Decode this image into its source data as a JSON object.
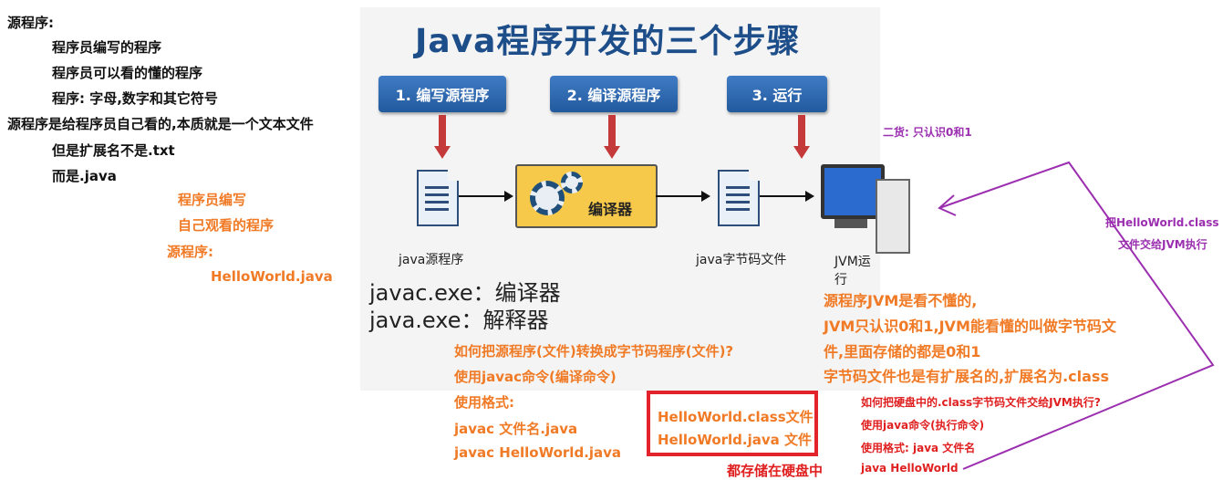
{
  "left_notes": {
    "l1": "源程序:",
    "l2": "程序员编写的程序",
    "l3": "程序员可以看的懂的程序",
    "l4": "程序: 字母,数字和其它符号",
    "l5": "源程序是给程序员自己看的,本质就是一个文本文件",
    "l6": "但是扩展名不是.txt",
    "l7": "而是.java"
  },
  "orange_notes": {
    "o1": "程序员编写",
    "o2": "自己观看的程序",
    "o3": "源程序:",
    "o4": "HelloWorld.java"
  },
  "slide": {
    "title": "Java程序开发的三个步骤",
    "steps": [
      "1. 编写源程序",
      "2. 编译源程序",
      "3. 运行"
    ],
    "compiler_label": "编译器",
    "captions": [
      "java源程序",
      "java字节码文件",
      "JVM运行"
    ],
    "javac": "javac.exe：编译器",
    "java": "java.exe：解释器"
  },
  "compile_notes": {
    "c1": "如何把源程序(文件)转换成字节码程序(文件)?",
    "c2": "使用javac命令(编译命令)",
    "c3": "使用格式:",
    "c4": "javac 文件名.java",
    "c5": "javac HelloWorld.java"
  },
  "box": {
    "b1": "HelloWorld.class文件",
    "b2": "HelloWorld.java 文件",
    "below": "都存储在硬盘中"
  },
  "jvm_notes": {
    "j1": "源程序JVM是看不懂的,",
    "j2": "JVM只认识0和1,JVM能看懂的叫做字节码文",
    "j3": "件,里面存储的都是0和1",
    "j4": "字节码文件也是有扩展名的,扩展名为.class"
  },
  "run_notes": {
    "r1": "如何把硬盘中的.class字节码文件交给JVM执行?",
    "r2": "使用java命令(执行命令)",
    "r3": "使用格式: java 文件名",
    "r4": "java HelloWorld"
  },
  "purple_notes": {
    "p1": "二货: 只认识0和1",
    "p2": "把HelloWorld.class",
    "p3": "文件交给JVM执行"
  },
  "colors": {
    "orange": "#f07a25",
    "red": "#e02020",
    "purple": "#9b2fb0",
    "title_blue": "#1d4e8a"
  }
}
